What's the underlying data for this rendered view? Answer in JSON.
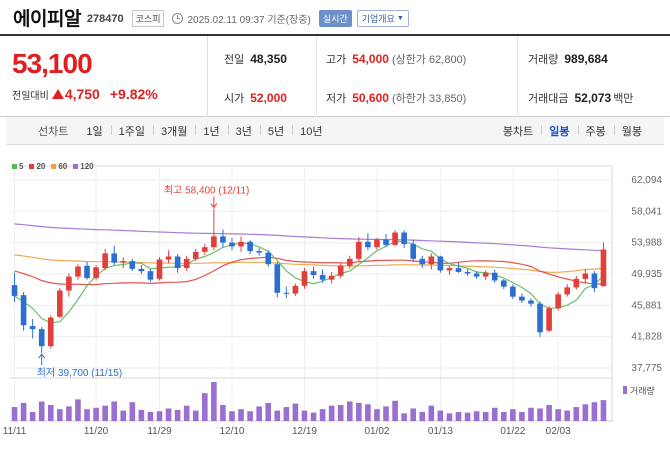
{
  "header": {
    "stock_name": "에이피알",
    "stock_code": "278470",
    "market": "코스피",
    "datetime": "2025.02.11 09:37 기준(장중)",
    "realtime_label": "실시간",
    "company_button": "기업개요"
  },
  "summary": {
    "current_price": "53,100",
    "change_label": "전일대비",
    "change_amount": "4,750",
    "change_percent": "+9.82%",
    "prev_close_label": "전일",
    "prev_close": "48,350",
    "high_label": "고가",
    "high": "54,000",
    "upper_limit": "(상한가 62,800)",
    "volume_label": "거래량",
    "volume": "989,684",
    "open_label": "시가",
    "open": "52,000",
    "low_label": "저가",
    "low": "50,600",
    "lower_limit": "(하한가 33,850)",
    "trade_value_label": "거래대금",
    "trade_value": "52,073",
    "trade_value_unit": "백만"
  },
  "period_bar": {
    "title": "선차트",
    "periods": [
      "1일",
      "1주일",
      "3개월",
      "1년",
      "3년",
      "5년",
      "10년"
    ],
    "candle_title": "봉차트",
    "candle_types": [
      "일봉",
      "주봉",
      "월봉"
    ],
    "candle_active": "일봉"
  },
  "colors": {
    "up": "#e0403c",
    "down": "#2d6fd0",
    "ma5": "#5cb85c",
    "ma20": "#e0403c",
    "ma60": "#f0a040",
    "ma120": "#9b6fcf"
  },
  "chart_data": {
    "type": "candlestick",
    "legend": [
      "5",
      "20",
      "60",
      "120"
    ],
    "y_ticks": [
      62094,
      58041,
      53988,
      49935,
      45881,
      41828,
      37775
    ],
    "x_ticks": [
      "11/11",
      "11/20",
      "11/29",
      "12/10",
      "12/19",
      "01/02",
      "01/13",
      "01/22",
      "02/03"
    ],
    "high_annotation": "최고 58,400 (12/11)",
    "low_annotation": "최저 39,700 (11/15)",
    "volume_label": "거래량",
    "candles": [
      [
        48500,
        50100,
        46300,
        47100
      ],
      [
        47200,
        47600,
        42600,
        43300
      ],
      [
        43200,
        44100,
        41600,
        42800
      ],
      [
        42800,
        43100,
        39700,
        40600
      ],
      [
        40600,
        44600,
        40300,
        44300
      ],
      [
        44400,
        48100,
        44200,
        47800
      ],
      [
        47800,
        50000,
        47000,
        49600
      ],
      [
        49600,
        51200,
        49200,
        50900
      ],
      [
        51000,
        51500,
        49200,
        49400
      ],
      [
        49400,
        51100,
        49100,
        50800
      ],
      [
        50700,
        53200,
        50400,
        52600
      ],
      [
        52600,
        53600,
        51100,
        51400
      ],
      [
        51400,
        52100,
        50700,
        51600
      ],
      [
        51600,
        51900,
        50300,
        50600
      ],
      [
        50600,
        51100,
        49900,
        50300
      ],
      [
        50300,
        50600,
        48900,
        49200
      ],
      [
        49300,
        52100,
        49100,
        51800
      ],
      [
        51800,
        53000,
        51300,
        52200
      ],
      [
        52200,
        52500,
        50100,
        50700
      ],
      [
        50700,
        52300,
        50300,
        51900
      ],
      [
        51900,
        53200,
        51600,
        52800
      ],
      [
        52800,
        53800,
        52400,
        53400
      ],
      [
        53400,
        58400,
        53000,
        54800
      ],
      [
        54800,
        55700,
        53400,
        54000
      ],
      [
        54000,
        54600,
        53000,
        53500
      ],
      [
        53500,
        54800,
        52800,
        54100
      ],
      [
        54100,
        54300,
        52500,
        52900
      ],
      [
        52900,
        53300,
        52300,
        52700
      ],
      [
        52700,
        53000,
        50900,
        51200
      ],
      [
        51200,
        51500,
        46900,
        47500
      ],
      [
        47500,
        48300,
        46800,
        47400
      ],
      [
        47400,
        48700,
        47100,
        48400
      ],
      [
        48400,
        50700,
        48000,
        50300
      ],
      [
        50300,
        50900,
        49300,
        49800
      ],
      [
        49800,
        50500,
        48800,
        49200
      ],
      [
        49200,
        50200,
        48700,
        49700
      ],
      [
        49700,
        51300,
        49400,
        51000
      ],
      [
        51000,
        52300,
        50600,
        51900
      ],
      [
        51900,
        54700,
        51500,
        54100
      ],
      [
        54100,
        55200,
        53000,
        53400
      ],
      [
        53400,
        54600,
        53100,
        54400
      ],
      [
        54400,
        55100,
        53400,
        53700
      ],
      [
        53700,
        55600,
        53500,
        55300
      ],
      [
        55300,
        55600,
        53300,
        53800
      ],
      [
        53800,
        54400,
        51500,
        51900
      ],
      [
        51900,
        52300,
        50700,
        51200
      ],
      [
        51200,
        52600,
        50500,
        52200
      ],
      [
        52200,
        52300,
        50100,
        50400
      ],
      [
        50400,
        51000,
        49800,
        50700
      ],
      [
        50700,
        51400,
        50100,
        50200
      ],
      [
        50200,
        50600,
        49700,
        50000
      ],
      [
        50000,
        50300,
        49300,
        49600
      ],
      [
        49600,
        50400,
        49200,
        50100
      ],
      [
        50100,
        50500,
        48800,
        49100
      ],
      [
        49100,
        49300,
        48000,
        48300
      ],
      [
        48300,
        48600,
        46700,
        47000
      ],
      [
        47000,
        47400,
        46200,
        46500
      ],
      [
        46500,
        46800,
        45700,
        46100
      ],
      [
        46100,
        46400,
        41800,
        42400
      ],
      [
        42600,
        45800,
        42400,
        45500
      ],
      [
        45500,
        47600,
        45200,
        47300
      ],
      [
        47300,
        48600,
        47000,
        48200
      ],
      [
        48200,
        49700,
        47900,
        49300
      ],
      [
        49300,
        50600,
        48700,
        50000
      ],
      [
        50000,
        50300,
        47600,
        48100
      ],
      [
        48350,
        54000,
        50600,
        53100
      ]
    ],
    "volume": [
      20,
      26,
      13,
      28,
      23,
      17,
      21,
      31,
      17,
      19,
      22,
      28,
      15,
      27,
      16,
      13,
      14,
      18,
      16,
      22,
      15,
      40,
      56,
      23,
      14,
      17,
      14,
      21,
      26,
      15,
      20,
      25,
      15,
      12,
      17,
      22,
      23,
      28,
      26,
      24,
      17,
      21,
      29,
      11,
      18,
      13,
      22,
      15,
      11,
      13,
      12,
      14,
      13,
      19,
      13,
      17,
      13,
      19,
      18,
      23,
      17,
      15,
      20,
      24,
      27,
      30
    ]
  }
}
